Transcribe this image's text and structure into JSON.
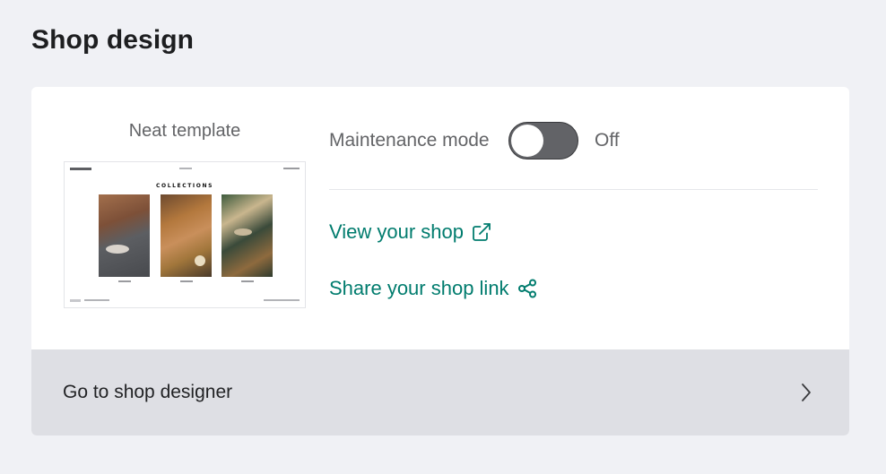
{
  "page": {
    "title": "Shop design"
  },
  "template": {
    "label": "Neat template",
    "preview": {
      "heading": "COLLECTIONS"
    }
  },
  "maintenance": {
    "label": "Maintenance mode",
    "enabled": false,
    "state_text": "Off"
  },
  "links": {
    "view_shop": "View your shop",
    "share_link": "Share your shop link"
  },
  "footer": {
    "label": "Go to shop designer"
  },
  "colors": {
    "accent": "#017c6e",
    "toggle_off": "#626367",
    "footer_bg": "#dedfe4",
    "page_bg": "#f0f1f5"
  },
  "icons": {
    "view_shop": "external-link-icon",
    "share_link": "share-icon",
    "footer": "chevron-right-icon"
  }
}
